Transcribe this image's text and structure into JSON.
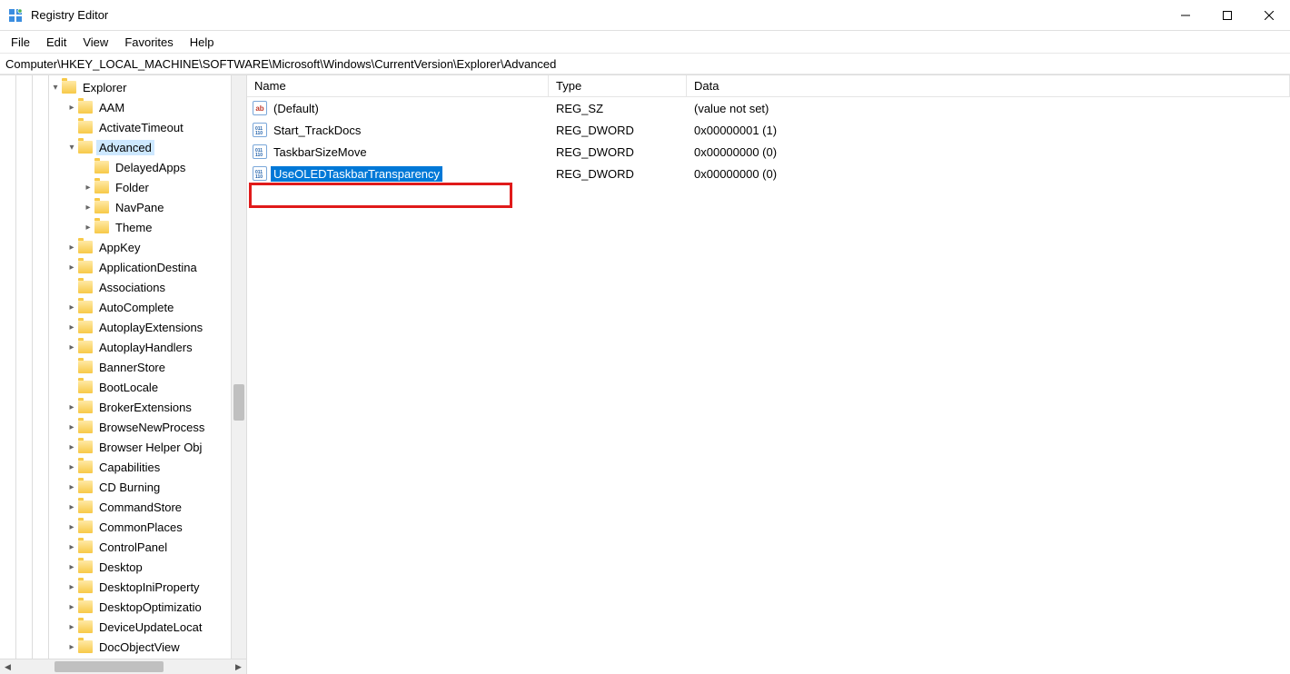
{
  "window": {
    "title": "Registry Editor"
  },
  "menu": {
    "file": "File",
    "edit": "Edit",
    "view": "View",
    "favorites": "Favorites",
    "help": "Help"
  },
  "address": "Computer\\HKEY_LOCAL_MACHINE\\SOFTWARE\\Microsoft\\Windows\\CurrentVersion\\Explorer\\Advanced",
  "columns": {
    "name": "Name",
    "type": "Type",
    "data": "Data"
  },
  "tree": {
    "root": "Explorer",
    "selected": "Advanced",
    "advanced_children": [
      "DelayedApps",
      "Folder",
      "NavPane",
      "Theme"
    ],
    "siblings": [
      "AAM",
      "ActivateTimeout",
      "Advanced",
      "AppKey",
      "ApplicationDestina",
      "Associations",
      "AutoComplete",
      "AutoplayExtensions",
      "AutoplayHandlers",
      "BannerStore",
      "BootLocale",
      "BrokerExtensions",
      "BrowseNewProcess",
      "Browser Helper Obj",
      "Capabilities",
      "CD Burning",
      "CommandStore",
      "CommonPlaces",
      "ControlPanel",
      "Desktop",
      "DesktopIniProperty",
      "DesktopOptimizatio",
      "DeviceUpdateLocat",
      "DocObjectView"
    ],
    "expandable": {
      "AAM": true,
      "AppKey": true,
      "ApplicationDestina": true,
      "AutoComplete": true,
      "AutoplayExtensions": true,
      "AutoplayHandlers": true,
      "BrokerExtensions": true,
      "BrowseNewProcess": true,
      "Browser Helper Obj": true,
      "Capabilities": true,
      "CD Burning": true,
      "CommandStore": true,
      "CommonPlaces": true,
      "ControlPanel": true,
      "Desktop": true,
      "DesktopIniProperty": true,
      "DesktopOptimizatio": true,
      "DeviceUpdateLocat": true,
      "DocObjectView": true,
      "Folder": true,
      "NavPane": true,
      "Theme": true
    }
  },
  "values": [
    {
      "name": "(Default)",
      "type": "REG_SZ",
      "data": "(value not set)",
      "icon": "sz"
    },
    {
      "name": "Start_TrackDocs",
      "type": "REG_DWORD",
      "data": "0x00000001 (1)",
      "icon": "dw"
    },
    {
      "name": "TaskbarSizeMove",
      "type": "REG_DWORD",
      "data": "0x00000000 (0)",
      "icon": "dw"
    },
    {
      "name": "UseOLEDTaskbarTransparency",
      "type": "REG_DWORD",
      "data": "0x00000000 (0)",
      "icon": "dw",
      "selected": true
    }
  ]
}
